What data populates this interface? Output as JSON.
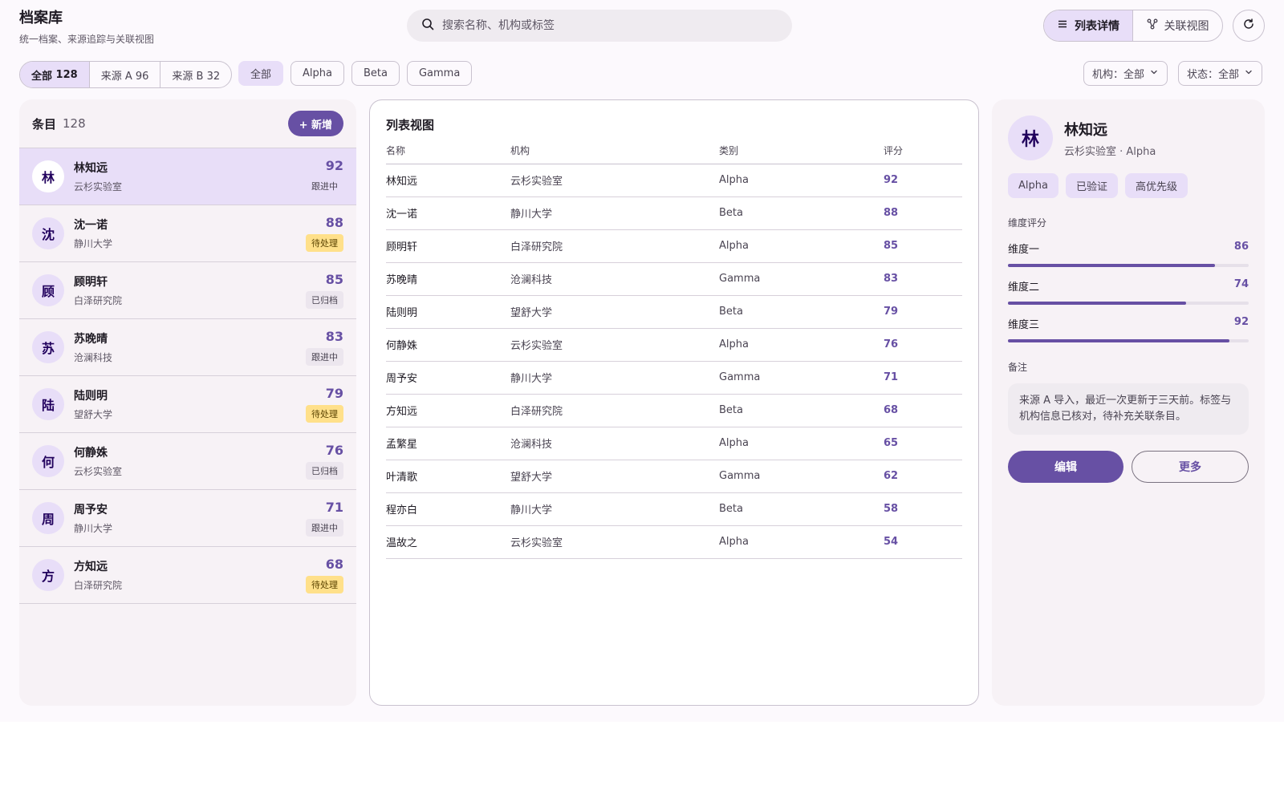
{
  "header": {
    "title": "档案库",
    "subtitle": "统一档案、来源追踪与关联视图",
    "search_placeholder": "搜索名称、机构或标签",
    "view_list": "列表详情",
    "view_graph": "关联视图"
  },
  "filters": {
    "sources": [
      {
        "label": "全部",
        "count": "128"
      },
      {
        "label": "来源 A 96"
      },
      {
        "label": "来源 B 32"
      }
    ],
    "categories": [
      "全部",
      "Alpha",
      "Beta",
      "Gamma"
    ],
    "org_dropdown": "机构：全部",
    "status_dropdown": "状态：全部"
  },
  "left_panel": {
    "title": "条目",
    "count": "128",
    "add_label": "+ 新增",
    "items": [
      {
        "avatar": "林",
        "name": "林知远",
        "org": "云杉实验室",
        "score": "92",
        "status": "跟进中",
        "status_kind": "track"
      },
      {
        "avatar": "沈",
        "name": "沈一诺",
        "org": "静川大学",
        "score": "88",
        "status": "待处理",
        "status_kind": "warn"
      },
      {
        "avatar": "顾",
        "name": "顾明轩",
        "org": "白泽研究院",
        "score": "85",
        "status": "已归档",
        "status_kind": "archived"
      },
      {
        "avatar": "苏",
        "name": "苏晚晴",
        "org": "沧澜科技",
        "score": "83",
        "status": "跟进中",
        "status_kind": "track"
      },
      {
        "avatar": "陆",
        "name": "陆则明",
        "org": "望舒大学",
        "score": "79",
        "status": "待处理",
        "status_kind": "warn"
      },
      {
        "avatar": "何",
        "name": "何静姝",
        "org": "云杉实验室",
        "score": "76",
        "status": "已归档",
        "status_kind": "archived"
      },
      {
        "avatar": "周",
        "name": "周予安",
        "org": "静川大学",
        "score": "71",
        "status": "跟进中",
        "status_kind": "track"
      },
      {
        "avatar": "方",
        "name": "方知远",
        "org": "白泽研究院",
        "score": "68",
        "status": "待处理",
        "status_kind": "warn"
      }
    ]
  },
  "middle_panel": {
    "title": "列表视图",
    "columns": [
      "名称",
      "机构",
      "类别",
      "评分"
    ],
    "rows": [
      [
        "林知远",
        "云杉实验室",
        "Alpha",
        "92"
      ],
      [
        "沈一诺",
        "静川大学",
        "Beta",
        "88"
      ],
      [
        "顾明轩",
        "白泽研究院",
        "Alpha",
        "85"
      ],
      [
        "苏晚晴",
        "沧澜科技",
        "Gamma",
        "83"
      ],
      [
        "陆则明",
        "望舒大学",
        "Beta",
        "79"
      ],
      [
        "何静姝",
        "云杉实验室",
        "Alpha",
        "76"
      ],
      [
        "周予安",
        "静川大学",
        "Gamma",
        "71"
      ],
      [
        "方知远",
        "白泽研究院",
        "Beta",
        "68"
      ],
      [
        "孟繁星",
        "沧澜科技",
        "Alpha",
        "65"
      ],
      [
        "叶清歌",
        "望舒大学",
        "Gamma",
        "62"
      ],
      [
        "程亦白",
        "静川大学",
        "Beta",
        "58"
      ],
      [
        "温故之",
        "云杉实验室",
        "Alpha",
        "54"
      ]
    ]
  },
  "detail": {
    "avatar": "林",
    "name": "林知远",
    "subtitle": "云杉实验室 · Alpha",
    "tags": [
      "Alpha",
      "已验证",
      "高优先级"
    ],
    "dims_label": "维度评分",
    "dims": [
      {
        "label": "维度一",
        "value": "86",
        "percent": 86
      },
      {
        "label": "维度二",
        "value": "74",
        "percent": 74
      },
      {
        "label": "维度三",
        "value": "92",
        "percent": 92
      }
    ],
    "note_label": "备注",
    "note": "来源 A 导入，最近一次更新于三天前。标签与机构信息已核对，待补充关联条目。",
    "edit_label": "编辑",
    "more_label": "更多"
  },
  "colors": {
    "accent": "#6750a4",
    "accent_container": "#e8def8",
    "warn": "#ffe08a"
  }
}
